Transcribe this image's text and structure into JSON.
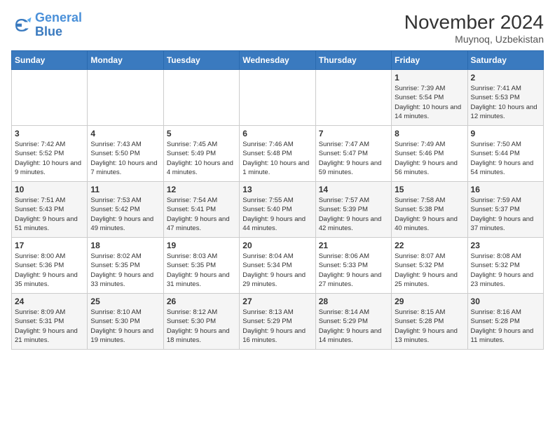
{
  "header": {
    "logo_line1": "General",
    "logo_line2": "Blue",
    "month": "November 2024",
    "location": "Muynoq, Uzbekistan"
  },
  "weekdays": [
    "Sunday",
    "Monday",
    "Tuesday",
    "Wednesday",
    "Thursday",
    "Friday",
    "Saturday"
  ],
  "weeks": [
    [
      {
        "day": "",
        "info": ""
      },
      {
        "day": "",
        "info": ""
      },
      {
        "day": "",
        "info": ""
      },
      {
        "day": "",
        "info": ""
      },
      {
        "day": "",
        "info": ""
      },
      {
        "day": "1",
        "info": "Sunrise: 7:39 AM\nSunset: 5:54 PM\nDaylight: 10 hours and 14 minutes."
      },
      {
        "day": "2",
        "info": "Sunrise: 7:41 AM\nSunset: 5:53 PM\nDaylight: 10 hours and 12 minutes."
      }
    ],
    [
      {
        "day": "3",
        "info": "Sunrise: 7:42 AM\nSunset: 5:52 PM\nDaylight: 10 hours and 9 minutes."
      },
      {
        "day": "4",
        "info": "Sunrise: 7:43 AM\nSunset: 5:50 PM\nDaylight: 10 hours and 7 minutes."
      },
      {
        "day": "5",
        "info": "Sunrise: 7:45 AM\nSunset: 5:49 PM\nDaylight: 10 hours and 4 minutes."
      },
      {
        "day": "6",
        "info": "Sunrise: 7:46 AM\nSunset: 5:48 PM\nDaylight: 10 hours and 1 minute."
      },
      {
        "day": "7",
        "info": "Sunrise: 7:47 AM\nSunset: 5:47 PM\nDaylight: 9 hours and 59 minutes."
      },
      {
        "day": "8",
        "info": "Sunrise: 7:49 AM\nSunset: 5:46 PM\nDaylight: 9 hours and 56 minutes."
      },
      {
        "day": "9",
        "info": "Sunrise: 7:50 AM\nSunset: 5:44 PM\nDaylight: 9 hours and 54 minutes."
      }
    ],
    [
      {
        "day": "10",
        "info": "Sunrise: 7:51 AM\nSunset: 5:43 PM\nDaylight: 9 hours and 51 minutes."
      },
      {
        "day": "11",
        "info": "Sunrise: 7:53 AM\nSunset: 5:42 PM\nDaylight: 9 hours and 49 minutes."
      },
      {
        "day": "12",
        "info": "Sunrise: 7:54 AM\nSunset: 5:41 PM\nDaylight: 9 hours and 47 minutes."
      },
      {
        "day": "13",
        "info": "Sunrise: 7:55 AM\nSunset: 5:40 PM\nDaylight: 9 hours and 44 minutes."
      },
      {
        "day": "14",
        "info": "Sunrise: 7:57 AM\nSunset: 5:39 PM\nDaylight: 9 hours and 42 minutes."
      },
      {
        "day": "15",
        "info": "Sunrise: 7:58 AM\nSunset: 5:38 PM\nDaylight: 9 hours and 40 minutes."
      },
      {
        "day": "16",
        "info": "Sunrise: 7:59 AM\nSunset: 5:37 PM\nDaylight: 9 hours and 37 minutes."
      }
    ],
    [
      {
        "day": "17",
        "info": "Sunrise: 8:00 AM\nSunset: 5:36 PM\nDaylight: 9 hours and 35 minutes."
      },
      {
        "day": "18",
        "info": "Sunrise: 8:02 AM\nSunset: 5:35 PM\nDaylight: 9 hours and 33 minutes."
      },
      {
        "day": "19",
        "info": "Sunrise: 8:03 AM\nSunset: 5:35 PM\nDaylight: 9 hours and 31 minutes."
      },
      {
        "day": "20",
        "info": "Sunrise: 8:04 AM\nSunset: 5:34 PM\nDaylight: 9 hours and 29 minutes."
      },
      {
        "day": "21",
        "info": "Sunrise: 8:06 AM\nSunset: 5:33 PM\nDaylight: 9 hours and 27 minutes."
      },
      {
        "day": "22",
        "info": "Sunrise: 8:07 AM\nSunset: 5:32 PM\nDaylight: 9 hours and 25 minutes."
      },
      {
        "day": "23",
        "info": "Sunrise: 8:08 AM\nSunset: 5:32 PM\nDaylight: 9 hours and 23 minutes."
      }
    ],
    [
      {
        "day": "24",
        "info": "Sunrise: 8:09 AM\nSunset: 5:31 PM\nDaylight: 9 hours and 21 minutes."
      },
      {
        "day": "25",
        "info": "Sunrise: 8:10 AM\nSunset: 5:30 PM\nDaylight: 9 hours and 19 minutes."
      },
      {
        "day": "26",
        "info": "Sunrise: 8:12 AM\nSunset: 5:30 PM\nDaylight: 9 hours and 18 minutes."
      },
      {
        "day": "27",
        "info": "Sunrise: 8:13 AM\nSunset: 5:29 PM\nDaylight: 9 hours and 16 minutes."
      },
      {
        "day": "28",
        "info": "Sunrise: 8:14 AM\nSunset: 5:29 PM\nDaylight: 9 hours and 14 minutes."
      },
      {
        "day": "29",
        "info": "Sunrise: 8:15 AM\nSunset: 5:28 PM\nDaylight: 9 hours and 13 minutes."
      },
      {
        "day": "30",
        "info": "Sunrise: 8:16 AM\nSunset: 5:28 PM\nDaylight: 9 hours and 11 minutes."
      }
    ]
  ]
}
